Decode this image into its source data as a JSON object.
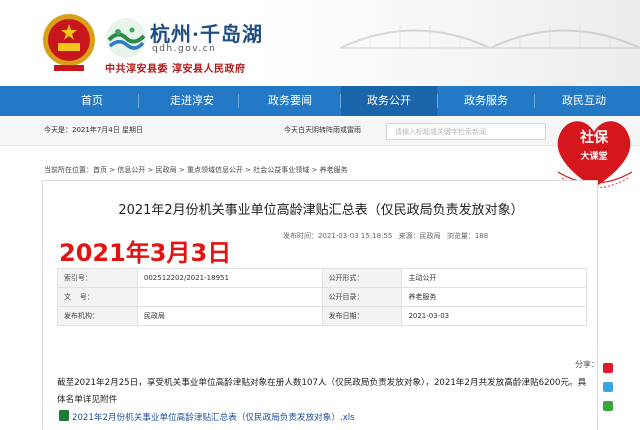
{
  "header": {
    "site_name": "杭州·千岛湖",
    "site_domain": "qdh.gov.cn",
    "gov_name": "中共淳安县委  淳安县人民政府"
  },
  "nav": {
    "items": [
      {
        "label": "首页"
      },
      {
        "label": "走进淳安"
      },
      {
        "label": "政务要闻"
      },
      {
        "label": "政务公开",
        "active": true
      },
      {
        "label": "政务服务"
      },
      {
        "label": "政民互动"
      }
    ]
  },
  "infobar": {
    "date": "今天是：2021年7月4日 星期日",
    "weather": "今天白天阴转阵雨或雷雨",
    "search_placeholder": "请输入标题或关键字检索新闻"
  },
  "badge": {
    "title": "社保",
    "subtitle": "大课堂"
  },
  "breadcrumb": "当前所在位置：首页 > 信息公开 > 民政局 > 重点领域信息公开 > 社会公益事业领域 > 养老服务",
  "article": {
    "title": "2021年2月份机关事业单位高龄津贴汇总表（仅民政局负责发放对象）",
    "meta": {
      "publish_time": "发布时间：2021-03-03 15:18:55",
      "source": "来源：民政局",
      "views": "浏览量：188"
    },
    "overlay_date": "2021年3月3日",
    "info_table": [
      {
        "k1": "索引号：",
        "v1": "002512202/2021-18951",
        "k2": "公开形式：",
        "v2": "主动公开"
      },
      {
        "k1": "文    号：",
        "v1": "",
        "k2": "公开目录：",
        "v2": "养老服务"
      },
      {
        "k1": "发布机构：",
        "v1": "民政局",
        "k2": "发布日期：",
        "v2": "2021-03-03"
      }
    ],
    "share_label": "分享：",
    "body": "截至2021年2月25日，享受机关事业单位高龄津贴对象在册人数107人（仅民政局负责发放对象），2021年2月共发放高龄津贴6200元。具体名单详见附件",
    "attachment": "2021年2月份机关事业单位高龄津贴汇总表（仅民政局负责发放对象）.xls"
  },
  "colors": {
    "nav_bg": "#2479c7",
    "nav_active": "#1a64a9",
    "overlay_red": "#e11414",
    "link_blue": "#1e4fa0"
  }
}
